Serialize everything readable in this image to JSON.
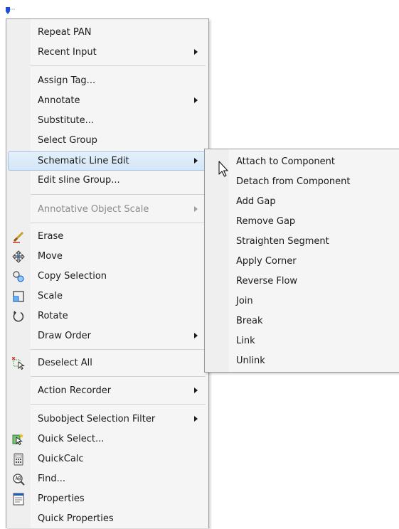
{
  "main_menu": {
    "items": [
      {
        "label": "Repeat PAN"
      },
      {
        "label": "Recent Input",
        "submenu": true
      },
      {
        "label": "Assign Tag..."
      },
      {
        "label": "Annotate",
        "submenu": true
      },
      {
        "label": "Substitute..."
      },
      {
        "label": "Select Group"
      },
      {
        "label": "Schematic Line Edit",
        "submenu": true,
        "highlighted": true
      },
      {
        "label": "Edit sline Group..."
      },
      {
        "label": "Annotative Object Scale",
        "submenu": true,
        "disabled": true
      },
      {
        "label": "Erase",
        "icon": "eraser-icon"
      },
      {
        "label": "Move",
        "icon": "move-icon"
      },
      {
        "label": "Copy Selection",
        "icon": "copy-selection-icon"
      },
      {
        "label": "Scale",
        "icon": "scale-icon"
      },
      {
        "label": "Rotate",
        "icon": "rotate-icon"
      },
      {
        "label": "Draw Order",
        "submenu": true
      },
      {
        "label": "Deselect All",
        "icon": "deselect-all-icon"
      },
      {
        "label": "Action Recorder",
        "submenu": true
      },
      {
        "label": "Subobject Selection Filter",
        "submenu": true
      },
      {
        "label": "Quick Select...",
        "icon": "quick-select-icon"
      },
      {
        "label": "QuickCalc",
        "icon": "calculator-icon"
      },
      {
        "label": "Find...",
        "icon": "find-text-icon"
      },
      {
        "label": "Properties",
        "icon": "properties-icon"
      },
      {
        "label": "Quick Properties"
      }
    ]
  },
  "submenu": {
    "items": [
      {
        "label": "Attach to Component"
      },
      {
        "label": "Detach from Component"
      },
      {
        "label": "Add Gap"
      },
      {
        "label": "Remove Gap"
      },
      {
        "label": "Straighten Segment"
      },
      {
        "label": "Apply Corner"
      },
      {
        "label": "Reverse Flow"
      },
      {
        "label": "Join"
      },
      {
        "label": "Break"
      },
      {
        "label": "Link"
      },
      {
        "label": "Unlink"
      }
    ]
  },
  "colors": {
    "highlight": "#d4e6f7",
    "highlight_border": "#9dc2e6",
    "grip": "#1b4fd6"
  }
}
